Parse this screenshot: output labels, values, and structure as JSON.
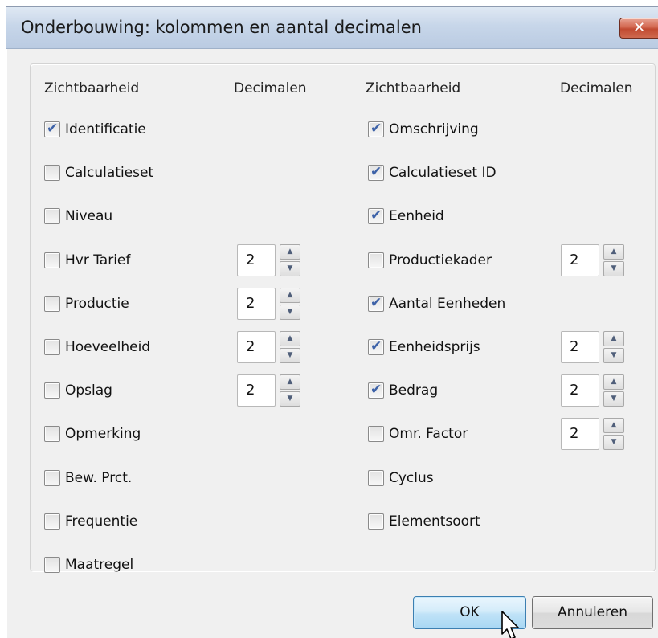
{
  "dialog": {
    "title": "Onderbouwing: kolommen en aantal decimalen",
    "close_symbol": "✕"
  },
  "headers": {
    "left_visibility": "Zichtbaarheid",
    "left_decimals": "Decimalen",
    "right_visibility": "Zichtbaarheid",
    "right_decimals": "Decimalen"
  },
  "left_columns": [
    {
      "label": "Identificatie",
      "checked": true,
      "decimals": null
    },
    {
      "label": "Calculatieset",
      "checked": false,
      "decimals": null
    },
    {
      "label": "Niveau",
      "checked": false,
      "decimals": null
    },
    {
      "label": "Hvr Tarief",
      "checked": false,
      "decimals": "2"
    },
    {
      "label": "Productie",
      "checked": false,
      "decimals": "2"
    },
    {
      "label": "Hoeveelheid",
      "checked": false,
      "decimals": "2"
    },
    {
      "label": "Opslag",
      "checked": false,
      "decimals": "2"
    },
    {
      "label": "Opmerking",
      "checked": false,
      "decimals": null
    },
    {
      "label": "Bew. Prct.",
      "checked": false,
      "decimals": null
    },
    {
      "label": "Frequentie",
      "checked": false,
      "decimals": null
    },
    {
      "label": "Maatregel",
      "checked": false,
      "decimals": null
    }
  ],
  "right_columns": [
    {
      "label": "Omschrijving",
      "checked": true,
      "decimals": null
    },
    {
      "label": "Calculatieset ID",
      "checked": true,
      "decimals": null
    },
    {
      "label": "Eenheid",
      "checked": true,
      "decimals": null
    },
    {
      "label": "Productiekader",
      "checked": false,
      "decimals": "2"
    },
    {
      "label": "Aantal Eenheden",
      "checked": true,
      "decimals": null
    },
    {
      "label": "Eenheidsprijs",
      "checked": true,
      "decimals": "2"
    },
    {
      "label": "Bedrag",
      "checked": true,
      "decimals": "2"
    },
    {
      "label": "Omr. Factor",
      "checked": false,
      "decimals": "2"
    },
    {
      "label": "Cyclus",
      "checked": false,
      "decimals": null
    },
    {
      "label": "Elementsoort",
      "checked": false,
      "decimals": null
    }
  ],
  "buttons": {
    "ok": "OK",
    "cancel": "Annuleren"
  },
  "icons": {
    "checkmark": "check-icon",
    "spin_up": "arrow-up-icon",
    "spin_down": "arrow-down-icon",
    "cursor": "mouse-pointer-icon"
  }
}
